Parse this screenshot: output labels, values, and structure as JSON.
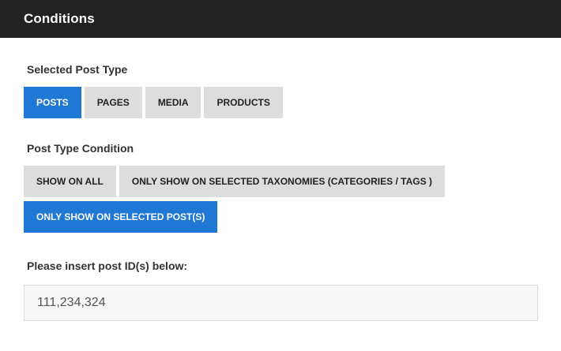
{
  "header": {
    "title": "Conditions"
  },
  "post_type": {
    "label": "Selected Post Type",
    "options": [
      "POSTS",
      "PAGES",
      "MEDIA",
      "PRODUCTS"
    ],
    "selected": "POSTS"
  },
  "condition": {
    "label": "Post Type Condition",
    "options": [
      "SHOW ON ALL",
      "ONLY SHOW ON SELECTED TAXONOMIES (CATEGORIES / TAGS )",
      "ONLY SHOW ON SELECTED POST(S)"
    ],
    "selected": "ONLY SHOW ON SELECTED POST(S)"
  },
  "post_ids": {
    "label": "Please insert post ID(s) below:",
    "value": "111,234,324"
  },
  "colors": {
    "header_bg": "#222222",
    "accent": "#1e78d4",
    "button_bg": "#dddddd"
  }
}
